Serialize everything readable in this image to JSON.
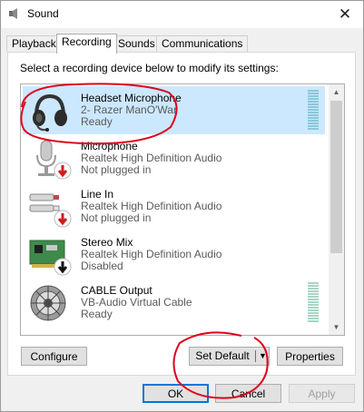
{
  "window": {
    "title": "Sound",
    "close_glyph": "✕"
  },
  "tabs": [
    {
      "label": "Playback",
      "active": false
    },
    {
      "label": "Recording",
      "active": true
    },
    {
      "label": "Sounds",
      "active": false
    },
    {
      "label": "Communications",
      "active": false
    }
  ],
  "instruction": "Select a recording device below to modify its settings:",
  "devices": [
    {
      "name": "Headset Microphone",
      "driver": "2- Razer ManO'War",
      "status": "Ready",
      "icon": "headset-icon",
      "selected": true
    },
    {
      "name": "Microphone",
      "driver": "Realtek High Definition Audio",
      "status": "Not plugged in",
      "icon": "microphone-icon",
      "selected": false
    },
    {
      "name": "Line In",
      "driver": "Realtek High Definition Audio",
      "status": "Not plugged in",
      "icon": "line-in-jack-icon",
      "selected": false
    },
    {
      "name": "Stereo Mix",
      "driver": "Realtek High Definition Audio",
      "status": "Disabled",
      "icon": "sound-card-icon",
      "selected": false
    },
    {
      "name": "CABLE Output",
      "driver": "VB-Audio Virtual Cable",
      "status": "Ready",
      "icon": "virtual-cable-icon",
      "selected": false
    }
  ],
  "buttons": {
    "configure": "Configure",
    "set_default": "Set Default",
    "set_default_arrow": "▼",
    "properties": "Properties",
    "ok": "OK",
    "cancel": "Cancel",
    "apply": "Apply"
  },
  "scrollbar": {
    "up_glyph": "▲",
    "down_glyph": "▼"
  },
  "colors": {
    "selection": "#cce8ff",
    "default_button_border": "#0078d7",
    "annotation_red": "#e0001b",
    "status_badge_red": "#d21a1a"
  }
}
